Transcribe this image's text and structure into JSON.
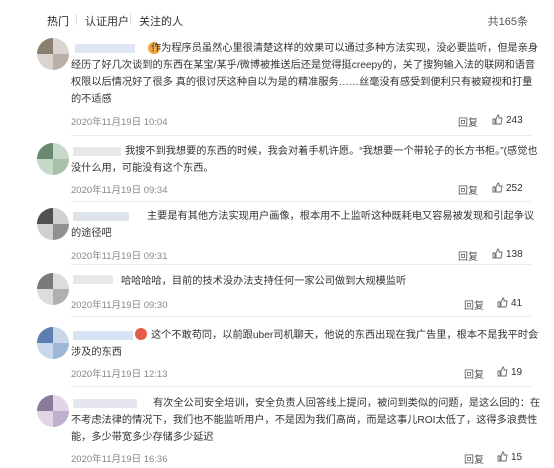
{
  "header": {
    "tabs": [
      "热门",
      "认证用户",
      "关注的人"
    ],
    "count": "共165条"
  },
  "actions": {
    "reply_label": "回复"
  },
  "colors": {
    "accent": "#f2a53a",
    "text": "#333333",
    "meta": "#888888",
    "badge": "#f2a53a"
  },
  "comments": [
    {
      "name_hidden": true,
      "badge": "!",
      "text": "作为程序员虽然心里很清楚这样的效果可以通过多种方法实现，没必要监听，但是亲身经历了好几次谈到的东西在某宝/某乎/微博被推送后还是觉得挺creepy的，关了搜狗输入法的联网和语音权限以后情况好了很多 真的很讨厌这种自以为是的精准服务……丝毫没有感受到便利只有被窥视和打量的不适感",
      "time": "2020年11月19日 10:04",
      "likes": "243"
    },
    {
      "name_hidden": true,
      "badge": "",
      "text": "我搜不到我想要的东西的时候，我会对着手机许愿。“我想要一个带轮子的长方书柜。”(感觉也没什么用，可能没有这个东西。",
      "time": "2020年11月19日 09:34",
      "likes": "252"
    },
    {
      "name_hidden": true,
      "badge": "",
      "text": "主要是有其他方法实现用户画像，根本用不上监听这种既耗电又容易被发现和引起争议的途径吧",
      "time": "2020年11月19日 09:31",
      "likes": "138"
    },
    {
      "name_hidden": true,
      "badge": "",
      "text": "哈哈哈哈，目前的技术没办法支持任何一家公司做到大规模监听",
      "time": "2020年11月19日 09:30",
      "likes": "41"
    },
    {
      "name_hidden": true,
      "badge": "",
      "text": "这个不敢苟同，以前跟uber司机聊天，他说的东西出现在我广告里，根本不是我平时会涉及的东西",
      "time": "2020年11月19日 12:13",
      "likes": "19"
    },
    {
      "name_hidden": true,
      "badge": "",
      "text": "有次全公司安全培训，安全负责人回答线上提问，被问到类似的问题，是这么回的：在不考虑法律的情况下，我们也不能监听用户，不是因为我们高尚，而是这事儿ROI太低了，这得多浪费性能，多少带宽多少存储多少延迟",
      "time": "2020年11月19日 16:36",
      "likes": "15"
    }
  ]
}
